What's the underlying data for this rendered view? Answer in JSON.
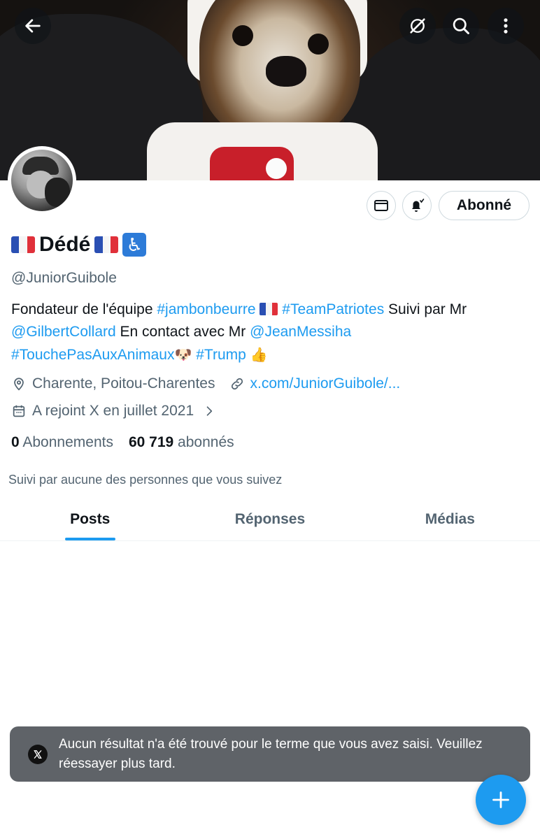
{
  "header": {
    "back_icon": "arrow-left-icon",
    "grok_icon": "grok-icon",
    "search_icon": "search-icon",
    "more_icon": "more-vertical-icon"
  },
  "profile": {
    "name": "Dédé",
    "handle": "@JuniorGuibole",
    "bio": {
      "t1": "Fondateur de l'équipe ",
      "tag1": "#jambonbeurre",
      "tag2": "#TeamPatriotes",
      "t2": " Suivi par Mr ",
      "mention1": "@GilbertCollard",
      "t3": "   En contact avec Mr ",
      "mention2": "@JeanMessiha",
      "tag3": "#TouchePasAuxAnimaux",
      "dog_emoji": "🐶",
      "tag4": "#Trump",
      "thumb_emoji": "👍"
    },
    "location": "Charente, Poitou-Charentes",
    "website": "x.com/JuniorGuibole/...",
    "joined": "A rejoint X en juillet 2021",
    "following_count": "0",
    "following_label": "Abonnements",
    "followers_count": "60 719",
    "followers_label": "abonnés",
    "followed_by": "Suivi par aucune des personnes que vous suivez",
    "wheelchair_symbol": "♿"
  },
  "actions": {
    "message_icon": "mail-icon",
    "notify_icon": "bell-notify-icon",
    "follow_label": "Abonné"
  },
  "tabs": [
    {
      "label": "Posts",
      "active": true
    },
    {
      "label": "Réponses",
      "active": false
    },
    {
      "label": "Médias",
      "active": false
    }
  ],
  "toast": {
    "message": "Aucun résultat n'a été trouvé pour le terme que vous avez saisi. Veuillez réessayer plus tard."
  },
  "colors": {
    "accent": "#1d9bf0",
    "text": "#0f1419",
    "muted": "#536471",
    "toast_bg": "#5f6368"
  }
}
